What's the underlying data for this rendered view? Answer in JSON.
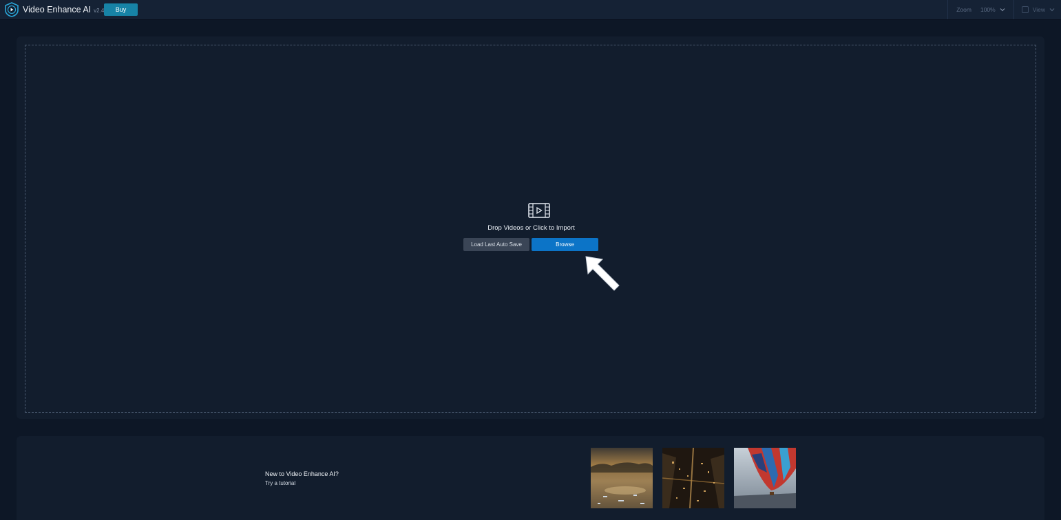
{
  "titlebar": {
    "app_name": "Video Enhance AI",
    "version": "v2.4.0",
    "buy_label": "Buy",
    "zoom_label": "Zoom",
    "zoom_value": "100%",
    "view_label": "View"
  },
  "dropzone": {
    "prompt": "Drop Videos or Click to Import",
    "load_autosave_label": "Load Last Auto Save",
    "browse_label": "Browse"
  },
  "tutorial": {
    "heading": "New to Video Enhance AI?",
    "link": "Try a tutorial",
    "thumbnails": [
      "lake-sunset",
      "city-night",
      "hot-air-balloon"
    ]
  },
  "colors": {
    "background": "#0d1726",
    "panel": "#121d2d",
    "titlebar": "#152235",
    "buy": "#1783a6",
    "browse": "#0c74c7",
    "secondary_button": "#3a4556"
  }
}
